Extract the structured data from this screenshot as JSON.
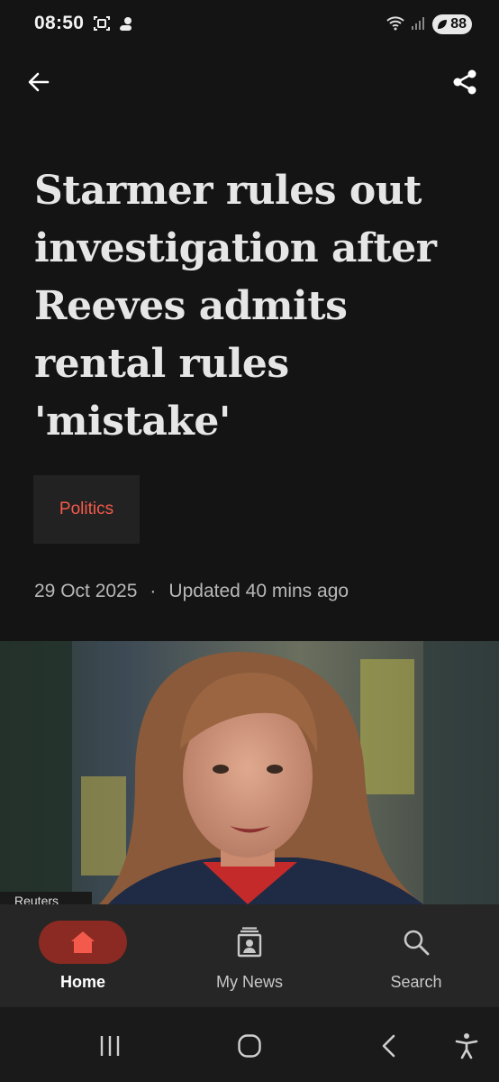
{
  "status_bar": {
    "time": "08:50",
    "battery": "88",
    "left_icons": [
      "screenshot-icon",
      "weather-icon"
    ],
    "right_icons": [
      "wifi-icon",
      "signal-icon",
      "battery-icon"
    ]
  },
  "header": {
    "back_icon": "arrow-left-icon",
    "share_icon": "share-icon"
  },
  "article": {
    "headline": "Starmer rules out investigation after Reeves admits rental rules 'mistake'",
    "topic": "Politics",
    "date": "29 Oct 2025",
    "separator": "·",
    "updated": "Updated 40 mins ago",
    "image_credit": "Reuters"
  },
  "bottom_nav": {
    "items": [
      {
        "label": "Home",
        "icon": "home-icon",
        "active": true
      },
      {
        "label": "My News",
        "icon": "my-news-icon",
        "active": false
      },
      {
        "label": "Search",
        "icon": "search-icon",
        "active": false
      }
    ]
  },
  "system_nav": {
    "buttons": [
      "recents-icon",
      "home-circle-icon",
      "back-chevron-icon",
      "accessibility-icon"
    ]
  },
  "colors": {
    "background": "#141414",
    "accent": "#f45a4b",
    "active_nav_pill": "#8a2a22",
    "nav_bar": "#262626"
  }
}
